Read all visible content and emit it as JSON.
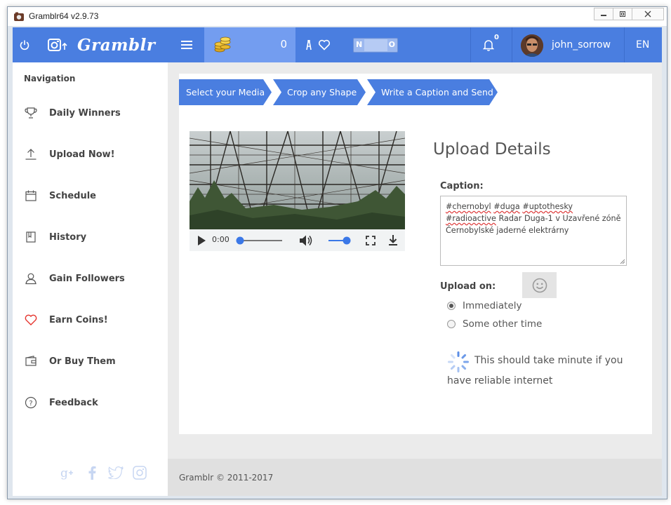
{
  "window": {
    "title": "Gramblr64 v2.9.73"
  },
  "topbar": {
    "brand": "Gramblr",
    "coins": "0",
    "toggle_on": "N",
    "toggle_off": "O",
    "notifications": "0",
    "username": "john_sorrow",
    "language": "EN",
    "accent": "#4a7ee0"
  },
  "sidebar": {
    "title": "Navigation",
    "items": [
      {
        "label": "Daily Winners",
        "icon": "trophy-icon"
      },
      {
        "label": "Upload Now!",
        "icon": "upload-icon"
      },
      {
        "label": "Schedule",
        "icon": "calendar-icon"
      },
      {
        "label": "History",
        "icon": "book-icon"
      },
      {
        "label": "Gain Followers",
        "icon": "user-icon"
      },
      {
        "label": "Earn Coins!",
        "icon": "heart-icon"
      },
      {
        "label": "Or Buy Them",
        "icon": "wallet-icon"
      },
      {
        "label": "Feedback",
        "icon": "question-icon"
      }
    ]
  },
  "steps": [
    "Select your Media",
    "Crop any Shape",
    "Write a Caption and Send"
  ],
  "player": {
    "time": "0:00"
  },
  "details": {
    "title": "Upload Details",
    "caption_label": "Caption:",
    "caption_tags": [
      "#chernobyl",
      "#duga",
      "#uptothesky",
      "#radioactive"
    ],
    "caption_text": "Radar Duga-1 v Uzavřené zóně Černobylské jaderné elektrárny",
    "upload_on_label": "Upload on:",
    "options": [
      "Immediately",
      "Some other time"
    ],
    "selected_option": "Immediately",
    "wait_line1": "This should take minute if you",
    "wait_line2": "have reliable internet"
  },
  "footer": {
    "text": "Gramblr © 2011-2017"
  }
}
